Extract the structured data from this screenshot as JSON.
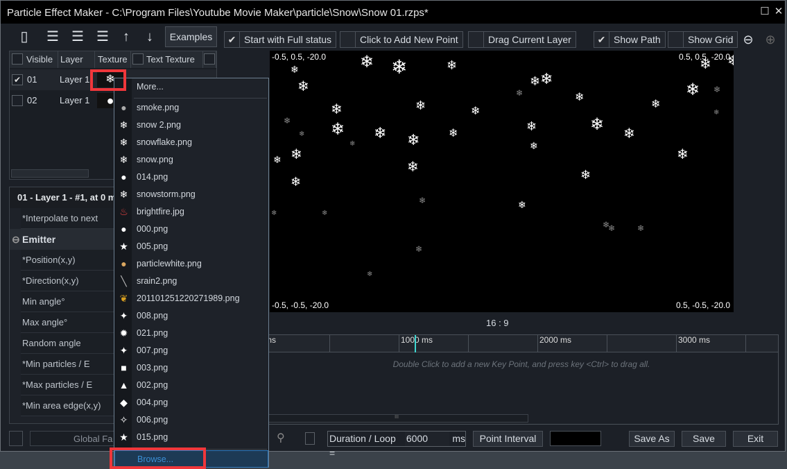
{
  "window": {
    "title": "Particle Effect Maker - C:\\Program Files\\Youtube Movie Maker\\particle\\Snow\\Snow 01.rzps*",
    "maximize_icon": "maximize-icon",
    "close_icon": "close-icon"
  },
  "toolbar": {
    "examples_label": "Examples",
    "start_full_status": {
      "label": "Start with Full status",
      "checked": true
    },
    "add_point": {
      "label": "Click to Add New Point",
      "checked": false
    },
    "drag_layer": {
      "label": "Drag Current Layer",
      "checked": false
    },
    "show_path": {
      "label": "Show Path",
      "checked": true
    },
    "show_grid": {
      "label": "Show Grid",
      "checked": false
    }
  },
  "layer_table": {
    "headers": [
      "Visible",
      "Layer",
      "Texture",
      "Text Texture"
    ],
    "rows": [
      {
        "id": "01",
        "layer": "Layer 1",
        "visible": true
      },
      {
        "id": "02",
        "layer": "Layer 1",
        "visible": false
      }
    ]
  },
  "properties": {
    "header": "01 - Layer 1 - #1, at 0 m",
    "interpolate": "*Interpolate to next",
    "section": "Emitter",
    "rows": [
      "*Position(x,y)",
      "*Direction(x,y)",
      "Min angle°",
      "Max angle°",
      "Random angle",
      "*Min particles / E",
      "*Max particles / E",
      "*Min area edge(x,y)"
    ],
    "global": "Global Fa"
  },
  "preview": {
    "top_left": "-0.5, 0.5, -20.0",
    "top_right": "0.5, 0.5, -20.0",
    "bottom_left": "-0.5, -0.5, -20.0",
    "bottom_right": "0.5, -0.5, -20.0",
    "aspect": "16 : 9"
  },
  "timeline": {
    "ticks": [
      "ms",
      "1000 ms",
      "2000 ms",
      "3000 ms"
    ],
    "hint": "Double Click to add a new Key Point, and press key <Ctrl> to drag all.",
    "scroll_grip": "III"
  },
  "bottom": {
    "duration_label": "Duration / Loop =",
    "duration_value": "6000",
    "unit": "ms",
    "point_interval": "Point Interval",
    "save_as": "Save As",
    "save": "Save",
    "exit": "Exit"
  },
  "texture_menu": {
    "more": "More...",
    "browse": "Browse...",
    "items": [
      {
        "label": "smoke.png",
        "icon": "smoke-icon"
      },
      {
        "label": "snow 2.png",
        "icon": "snowflake-icon"
      },
      {
        "label": "snowflake.png",
        "icon": "snowflake-icon"
      },
      {
        "label": "snow.png",
        "icon": "snowflake-icon"
      },
      {
        "label": "014.png",
        "icon": "circle-icon"
      },
      {
        "label": "snowstorm.png",
        "icon": "snowflake-icon"
      },
      {
        "label": "brightfire.jpg",
        "icon": "fire-icon"
      },
      {
        "label": "000.png",
        "icon": "circle-icon"
      },
      {
        "label": "005.png",
        "icon": "star-icon"
      },
      {
        "label": "particlewhite.png",
        "icon": "glow-icon"
      },
      {
        "label": "srain2.png",
        "icon": "rain-streak-icon"
      },
      {
        "label": "201101251220271989.png",
        "icon": "leaf-icon"
      },
      {
        "label": "008.png",
        "icon": "sparkle-icon"
      },
      {
        "label": "021.png",
        "icon": "burst-icon"
      },
      {
        "label": "007.png",
        "icon": "four-point-star-icon"
      },
      {
        "label": "003.png",
        "icon": "square-icon"
      },
      {
        "label": "002.png",
        "icon": "triangle-icon"
      },
      {
        "label": "004.png",
        "icon": "diamond-icon"
      },
      {
        "label": "006.png",
        "icon": "concave-square-icon"
      },
      {
        "label": "015.png",
        "icon": "star-icon"
      }
    ]
  }
}
